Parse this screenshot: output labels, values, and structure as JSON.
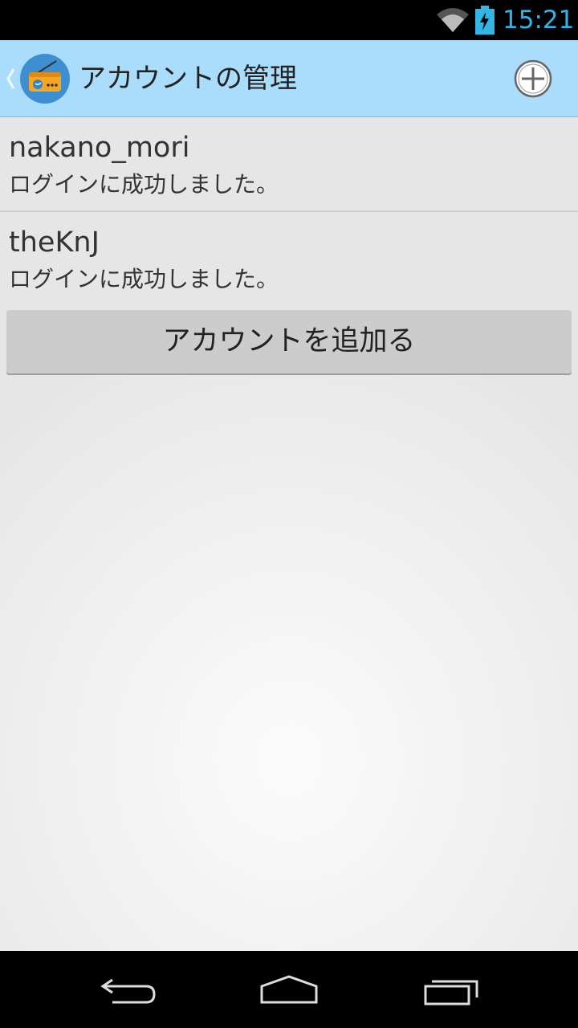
{
  "status_bar": {
    "time": "15:21",
    "accent_color": "#33b5e5",
    "icons": [
      "wifi-icon",
      "battery-charging-icon"
    ]
  },
  "action_bar": {
    "title": "アカウントの管理",
    "background": "#aadcfb",
    "icons": [
      "up-caret-icon",
      "radio-app-icon",
      "add-circle-icon"
    ]
  },
  "accounts": [
    {
      "name": "nakano_mori",
      "status": "ログインに成功しました。"
    },
    {
      "name": "theKnJ",
      "status": "ログインに成功しました。"
    }
  ],
  "add_account_button": {
    "label": "アカウントを追加る"
  },
  "nav_bar": {
    "icons": [
      "back-icon",
      "home-icon",
      "recent-apps-icon"
    ]
  }
}
